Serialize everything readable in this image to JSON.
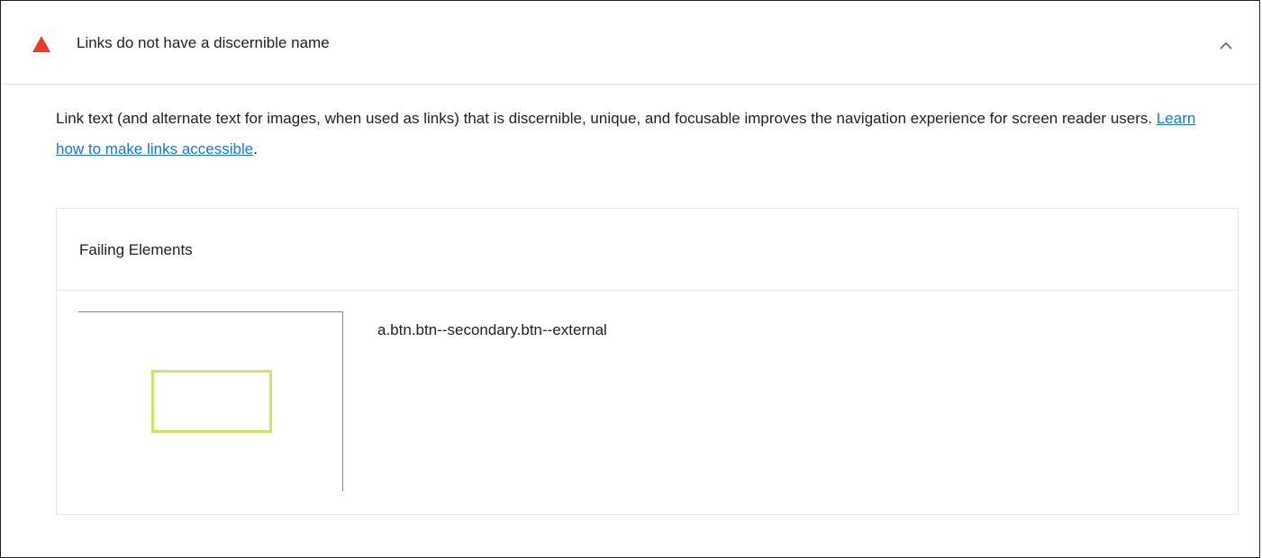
{
  "audit": {
    "title": "Links do not have a discernible name",
    "status_icon": "warning-triangle-icon",
    "status_color": "#eb3a2f",
    "expand_icon": "chevron-up-icon"
  },
  "description": {
    "text_before": "Link text (and alternate text for images, when used as links) that is discernible, unique, and focusable improves the navigation experience for screen reader users. ",
    "link_text": "Learn how to make links accessible",
    "text_after": ".",
    "link_color": "#1a73e8"
  },
  "details": {
    "heading": "Failing Elements",
    "items": [
      {
        "selector": "a.btn.btn--secondary.btn--external",
        "highlight_color": "#d5e162"
      }
    ]
  }
}
